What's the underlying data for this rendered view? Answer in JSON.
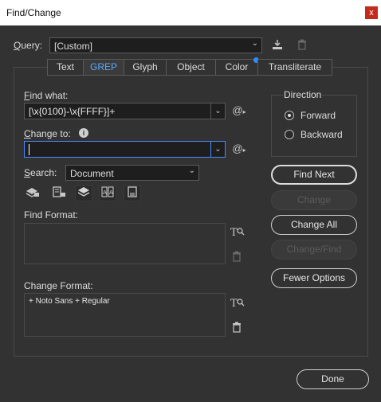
{
  "window": {
    "title": "Find/Change",
    "close_glyph": "x"
  },
  "query": {
    "label_letter": "Q",
    "label_rest": "uery:",
    "value": "[Custom]"
  },
  "tabs": [
    {
      "label": "Text",
      "active": false
    },
    {
      "label": "GREP",
      "active": true
    },
    {
      "label": "Glyph",
      "active": false
    },
    {
      "label": "Object",
      "active": false
    },
    {
      "label": "Color",
      "active": false,
      "has_dot": true
    },
    {
      "label": "Transliterate",
      "active": false
    }
  ],
  "find_what": {
    "label_letter": "F",
    "label_rest": "ind what:",
    "value": "[\\x{0100}-\\x{FFFF}]+"
  },
  "change_to": {
    "label_letter": "C",
    "label_rest": "hange to:",
    "value": ""
  },
  "search": {
    "label_letter": "S",
    "label_rest": "earch:",
    "value": "Document"
  },
  "special_char_glyph": "@",
  "info_glyph": "i",
  "find_format": {
    "label": "Find Format:",
    "value": ""
  },
  "change_format": {
    "label": "Change Format:",
    "value": "+ Noto Sans + Regular"
  },
  "direction": {
    "label": "Direction",
    "forward": "Forward",
    "backward": "Backward",
    "selected": "forward"
  },
  "buttons": {
    "find_next": "Find Next",
    "change": "Change",
    "change_all": "Change All",
    "change_find": "Change/Find",
    "fewer_options": "Fewer Options",
    "done": "Done"
  },
  "option_icons": [
    "include-locked-layers-icon",
    "include-locked-stories-icon",
    "include-hidden-layers-icon",
    "include-master-pages-icon",
    "include-footnotes-icon"
  ],
  "colors": {
    "accent": "#5aa9ff",
    "dot": "#2f8cff",
    "close": "#c42b1c"
  }
}
